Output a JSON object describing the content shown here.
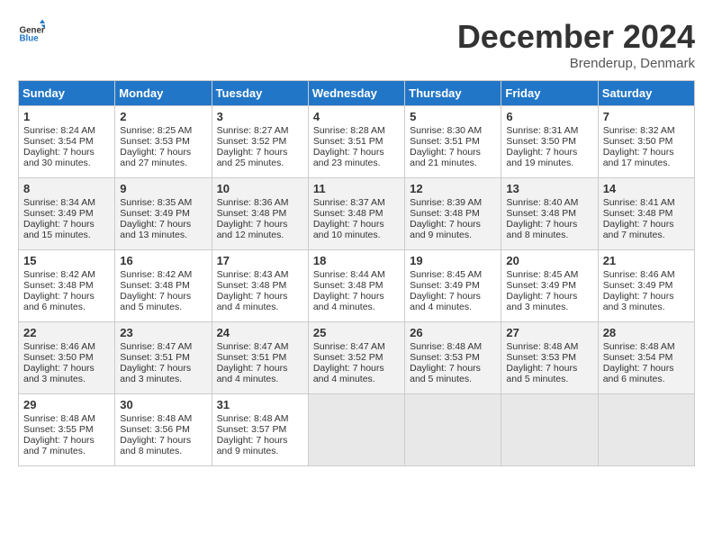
{
  "header": {
    "logo_line1": "General",
    "logo_line2": "Blue",
    "month": "December 2024",
    "location": "Brenderup, Denmark"
  },
  "days_of_week": [
    "Sunday",
    "Monday",
    "Tuesday",
    "Wednesday",
    "Thursday",
    "Friday",
    "Saturday"
  ],
  "weeks": [
    [
      {
        "day": "1",
        "info": "Sunrise: 8:24 AM\nSunset: 3:54 PM\nDaylight: 7 hours\nand 30 minutes."
      },
      {
        "day": "2",
        "info": "Sunrise: 8:25 AM\nSunset: 3:53 PM\nDaylight: 7 hours\nand 27 minutes."
      },
      {
        "day": "3",
        "info": "Sunrise: 8:27 AM\nSunset: 3:52 PM\nDaylight: 7 hours\nand 25 minutes."
      },
      {
        "day": "4",
        "info": "Sunrise: 8:28 AM\nSunset: 3:51 PM\nDaylight: 7 hours\nand 23 minutes."
      },
      {
        "day": "5",
        "info": "Sunrise: 8:30 AM\nSunset: 3:51 PM\nDaylight: 7 hours\nand 21 minutes."
      },
      {
        "day": "6",
        "info": "Sunrise: 8:31 AM\nSunset: 3:50 PM\nDaylight: 7 hours\nand 19 minutes."
      },
      {
        "day": "7",
        "info": "Sunrise: 8:32 AM\nSunset: 3:50 PM\nDaylight: 7 hours\nand 17 minutes."
      }
    ],
    [
      {
        "day": "8",
        "info": "Sunrise: 8:34 AM\nSunset: 3:49 PM\nDaylight: 7 hours\nand 15 minutes."
      },
      {
        "day": "9",
        "info": "Sunrise: 8:35 AM\nSunset: 3:49 PM\nDaylight: 7 hours\nand 13 minutes."
      },
      {
        "day": "10",
        "info": "Sunrise: 8:36 AM\nSunset: 3:48 PM\nDaylight: 7 hours\nand 12 minutes."
      },
      {
        "day": "11",
        "info": "Sunrise: 8:37 AM\nSunset: 3:48 PM\nDaylight: 7 hours\nand 10 minutes."
      },
      {
        "day": "12",
        "info": "Sunrise: 8:39 AM\nSunset: 3:48 PM\nDaylight: 7 hours\nand 9 minutes."
      },
      {
        "day": "13",
        "info": "Sunrise: 8:40 AM\nSunset: 3:48 PM\nDaylight: 7 hours\nand 8 minutes."
      },
      {
        "day": "14",
        "info": "Sunrise: 8:41 AM\nSunset: 3:48 PM\nDaylight: 7 hours\nand 7 minutes."
      }
    ],
    [
      {
        "day": "15",
        "info": "Sunrise: 8:42 AM\nSunset: 3:48 PM\nDaylight: 7 hours\nand 6 minutes."
      },
      {
        "day": "16",
        "info": "Sunrise: 8:42 AM\nSunset: 3:48 PM\nDaylight: 7 hours\nand 5 minutes."
      },
      {
        "day": "17",
        "info": "Sunrise: 8:43 AM\nSunset: 3:48 PM\nDaylight: 7 hours\nand 4 minutes."
      },
      {
        "day": "18",
        "info": "Sunrise: 8:44 AM\nSunset: 3:48 PM\nDaylight: 7 hours\nand 4 minutes."
      },
      {
        "day": "19",
        "info": "Sunrise: 8:45 AM\nSunset: 3:49 PM\nDaylight: 7 hours\nand 4 minutes."
      },
      {
        "day": "20",
        "info": "Sunrise: 8:45 AM\nSunset: 3:49 PM\nDaylight: 7 hours\nand 3 minutes."
      },
      {
        "day": "21",
        "info": "Sunrise: 8:46 AM\nSunset: 3:49 PM\nDaylight: 7 hours\nand 3 minutes."
      }
    ],
    [
      {
        "day": "22",
        "info": "Sunrise: 8:46 AM\nSunset: 3:50 PM\nDaylight: 7 hours\nand 3 minutes."
      },
      {
        "day": "23",
        "info": "Sunrise: 8:47 AM\nSunset: 3:51 PM\nDaylight: 7 hours\nand 3 minutes."
      },
      {
        "day": "24",
        "info": "Sunrise: 8:47 AM\nSunset: 3:51 PM\nDaylight: 7 hours\nand 4 minutes."
      },
      {
        "day": "25",
        "info": "Sunrise: 8:47 AM\nSunset: 3:52 PM\nDaylight: 7 hours\nand 4 minutes."
      },
      {
        "day": "26",
        "info": "Sunrise: 8:48 AM\nSunset: 3:53 PM\nDaylight: 7 hours\nand 5 minutes."
      },
      {
        "day": "27",
        "info": "Sunrise: 8:48 AM\nSunset: 3:53 PM\nDaylight: 7 hours\nand 5 minutes."
      },
      {
        "day": "28",
        "info": "Sunrise: 8:48 AM\nSunset: 3:54 PM\nDaylight: 7 hours\nand 6 minutes."
      }
    ],
    [
      {
        "day": "29",
        "info": "Sunrise: 8:48 AM\nSunset: 3:55 PM\nDaylight: 7 hours\nand 7 minutes."
      },
      {
        "day": "30",
        "info": "Sunrise: 8:48 AM\nSunset: 3:56 PM\nDaylight: 7 hours\nand 8 minutes."
      },
      {
        "day": "31",
        "info": "Sunrise: 8:48 AM\nSunset: 3:57 PM\nDaylight: 7 hours\nand 9 minutes."
      },
      {
        "day": "",
        "info": ""
      },
      {
        "day": "",
        "info": ""
      },
      {
        "day": "",
        "info": ""
      },
      {
        "day": "",
        "info": ""
      }
    ]
  ]
}
